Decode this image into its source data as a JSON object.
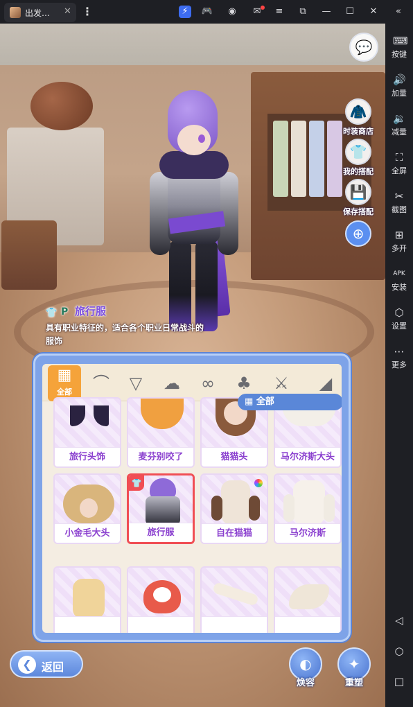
{
  "titlebar": {
    "tab_title": "出发…",
    "tab_close": "✕",
    "more": "⋮",
    "icons": [
      "bolt-icon",
      "gamepad-icon",
      "account-icon",
      "mail-icon",
      "menu-icon",
      "screen-capture-icon",
      "minimize-icon",
      "maximize-icon",
      "close-icon",
      "collapse-icon"
    ]
  },
  "sidebar": {
    "items": [
      {
        "label": "按键",
        "icon": "keyboard-icon"
      },
      {
        "label": "加量",
        "icon": "volume-up-icon"
      },
      {
        "label": "减量",
        "icon": "volume-down-icon"
      },
      {
        "label": "全屏",
        "icon": "fullscreen-icon"
      },
      {
        "label": "截图",
        "icon": "scissors-icon"
      },
      {
        "label": "多开",
        "icon": "multi-instance-icon"
      },
      {
        "label": "安装",
        "icon": "apk-icon"
      },
      {
        "label": "设置",
        "icon": "settings-icon"
      },
      {
        "label": "更多",
        "icon": "more-icon"
      }
    ],
    "nav": [
      "back-nav-icon",
      "home-nav-icon",
      "recent-apps-icon"
    ]
  },
  "game": {
    "side_buttons": {
      "fashion_shop": "时装商店",
      "my_outfits": "我的搭配",
      "save_outfit": "保存搭配"
    },
    "item_info": {
      "name": "旅行服",
      "badge": "P",
      "description_line1": "具有职业特征的，适合各个职业日常战斗的",
      "description_line2": "服饰"
    },
    "wardrobe": {
      "all_tab_label": "全部",
      "filter_label": "全部",
      "categories": [
        "ears-icon",
        "mask-icon",
        "hair-icon",
        "eyewear-icon",
        "outfit-icon",
        "weapon-icon",
        "wing-icon"
      ],
      "items": [
        {
          "label": "旅行头饰"
        },
        {
          "label": "麦芬别咬了"
        },
        {
          "label": "猫猫头"
        },
        {
          "label": "马尔济斯大头"
        },
        {
          "label": "小金毛大头"
        },
        {
          "label": "旅行服",
          "selected": true
        },
        {
          "label": "自在猫猫"
        },
        {
          "label": "马尔济斯"
        },
        {
          "label": ""
        },
        {
          "label": ""
        },
        {
          "label": ""
        },
        {
          "label": ""
        }
      ]
    },
    "bottom": {
      "back": "返回",
      "makeover": "焕容",
      "reshape": "重塑"
    }
  },
  "colors": {
    "accent_purple": "#8a3fcf",
    "panel_blue": "#7ea3e8",
    "selected_red": "#f04e54",
    "all_tab_orange": "#f5a33a"
  }
}
